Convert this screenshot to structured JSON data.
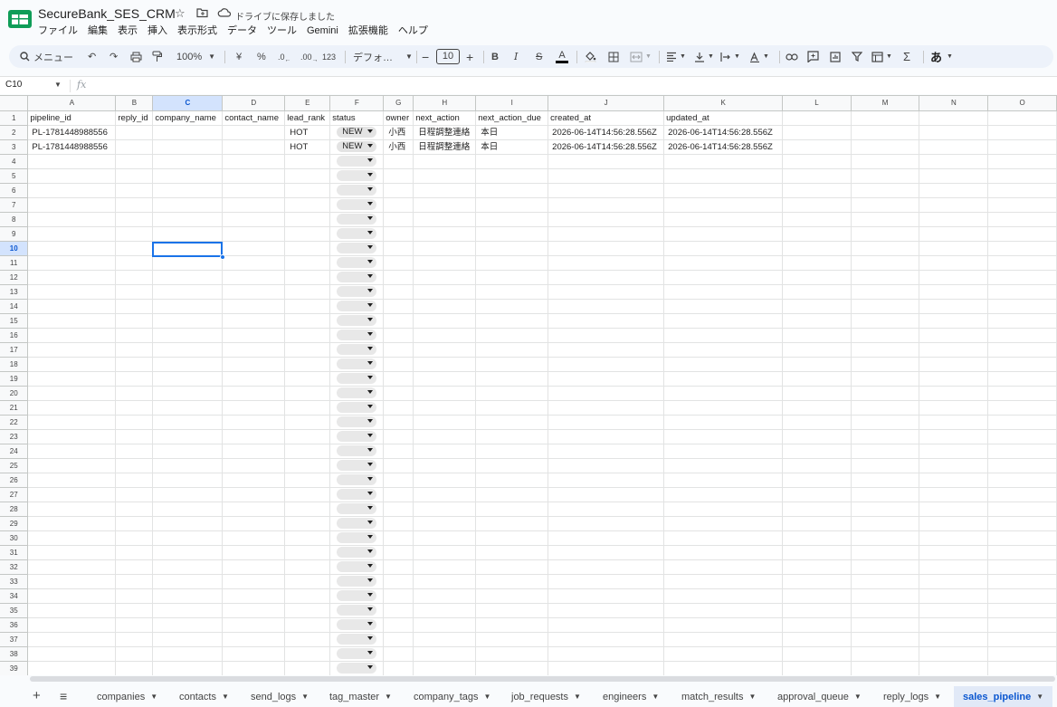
{
  "app": {
    "doc_title": "SecureBank_SES_CRM",
    "save_status": "ドライブに保存しました",
    "brand_color": "#0f9d58"
  },
  "menu": [
    "ファイル",
    "編集",
    "表示",
    "挿入",
    "表示形式",
    "データ",
    "ツール",
    "Gemini",
    "拡張機能",
    "ヘルプ"
  ],
  "toolbar": {
    "search_label": "メニュー",
    "zoom": "100%",
    "currency": "¥",
    "percent": "%",
    "dec_decrease": ".0",
    "dec_increase": ".00",
    "number_format": "123",
    "font": "デフォ…",
    "font_size": "10",
    "bold": "B",
    "italic": "I",
    "strike": "S",
    "text_color": "A",
    "input_tool": "あ",
    "sum": "Σ"
  },
  "formula_bar": {
    "cell_ref": "C10",
    "fx": "fx",
    "value": ""
  },
  "columns": [
    "A",
    "B",
    "C",
    "D",
    "E",
    "F",
    "G",
    "H",
    "I",
    "J",
    "K",
    "L",
    "M",
    "N",
    "O"
  ],
  "selected_column": "C",
  "selected_row": 10,
  "header_row": [
    "pipeline_id",
    "reply_id",
    "company_name",
    "contact_name",
    "lead_rank",
    "status",
    "owner",
    "next_action",
    "next_action_due",
    "created_at",
    "updated_at"
  ],
  "rows": [
    [
      "PL-1781448988556",
      "",
      "",
      "",
      "HOT",
      "NEW",
      "小西",
      "日程調整連絡",
      "本日",
      "2026-06-14T14:56:28.556Z",
      "2026-06-14T14:56:28.556Z"
    ],
    [
      "PL-1781448988556",
      "",
      "",
      "",
      "HOT",
      "NEW",
      "小西",
      "日程調整連絡",
      "本日",
      "2026-06-14T14:56:28.556Z",
      "2026-06-14T14:56:28.556Z"
    ]
  ],
  "visible_row_count": 39,
  "sheets": [
    {
      "name": "companies"
    },
    {
      "name": "contacts"
    },
    {
      "name": "send_logs"
    },
    {
      "name": "tag_master"
    },
    {
      "name": "company_tags"
    },
    {
      "name": "job_requests"
    },
    {
      "name": "engineers"
    },
    {
      "name": "match_results"
    },
    {
      "name": "approval_queue"
    },
    {
      "name": "reply_logs"
    },
    {
      "name": "sales_pipeline",
      "active": true
    }
  ]
}
